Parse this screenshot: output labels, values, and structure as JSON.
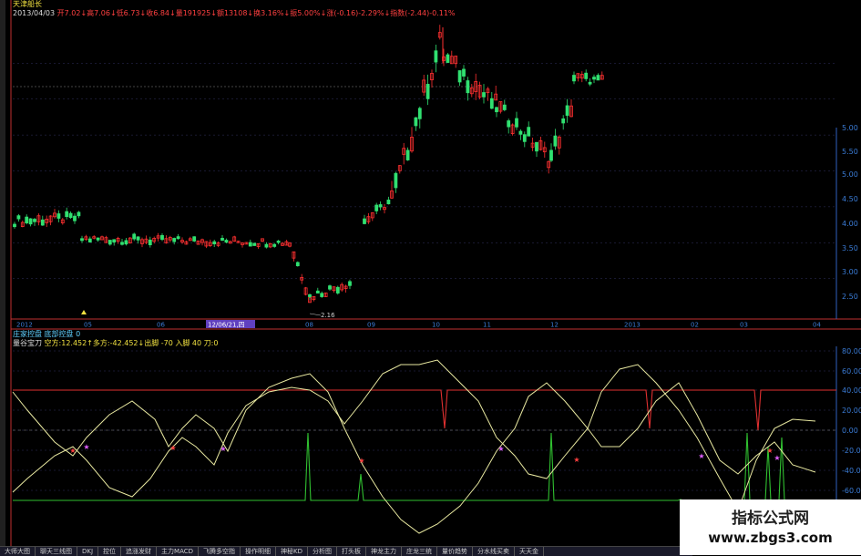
{
  "header": {
    "stock_name": "天津船长",
    "date": "2013/04/03",
    "line1": "开7.02↓高7.06↓低6.73↓收6.84↓量191925↓额13108↓换3.16%↓振5.00%↓涨(-0.16)-2.29%↓指数(-2.44)-0.11%"
  },
  "sub_header": {
    "tabs_line": "庄家控盘  底部控盘  0",
    "indicator_line_name": "量谷宝刀",
    "indicator_line_values": "空方:12.452↑多方:-42.452↓出脚 -70  入脚 40  刀:0"
  },
  "date_axis": [
    "2012",
    "05",
    "06",
    "12/06/21,四",
    "08",
    "09",
    "10",
    "11",
    "12",
    "2013",
    "02",
    "03",
    "04"
  ],
  "price_axis": [
    "5.00",
    "5.50",
    "5.00",
    "4.50",
    "4.00",
    "3.50",
    "3.00",
    "2.50"
  ],
  "indicator_axis": [
    "80.00",
    "60.00",
    "40.00",
    "20.00",
    "0.00",
    "-20.00",
    "-40.00",
    "-60.00"
  ],
  "annotations": {
    "low_label": "2.16"
  },
  "bottom_tabs": [
    "大师大图",
    "聊天三线图",
    "DKJ",
    "控位",
    "追涨发财",
    "主力MACD",
    "飞腾多空指",
    "操作明细",
    "神秘KD",
    "分析图",
    "打头板",
    "神龙主力",
    "庄龙三统",
    "量价趋势",
    "分水线买卖",
    "天天金"
  ],
  "watermark": {
    "line1": "指标公式网",
    "line2": "www.zbgs3.com"
  },
  "chart_data": [
    {
      "type": "candlestick",
      "title": "",
      "ylim": [
        2.0,
        6.0
      ],
      "price_levels": [
        5.5,
        5.0,
        4.5,
        4.0,
        3.5,
        3.0,
        2.5
      ],
      "segments": [
        {
          "from": "2012",
          "to": "05",
          "start": 3.3,
          "end": 3.35
        },
        {
          "from": "05",
          "to": "08",
          "start": 3.1,
          "end": 3.0
        },
        {
          "from": "08",
          "to": "09",
          "start": 3.0,
          "end": 2.2
        },
        {
          "from": "09",
          "to": "10",
          "start": 2.5,
          "end": 3.4
        },
        {
          "from": "10",
          "to": "10",
          "start": 3.6,
          "end": 6.0
        },
        {
          "from": "10",
          "to": "12",
          "start": 5.6,
          "end": 4.2
        },
        {
          "from": "12",
          "to": "2013",
          "start": 4.2,
          "end": 5.3
        }
      ],
      "low": 2.16,
      "high": 6.0
    },
    {
      "type": "line",
      "title": "",
      "ylim": [
        -80,
        90
      ],
      "levels": [
        40,
        -70
      ],
      "series": [
        {
          "name": "空方",
          "last_value": 12.452
        },
        {
          "name": "多方",
          "last_value": -42.452
        }
      ]
    }
  ]
}
